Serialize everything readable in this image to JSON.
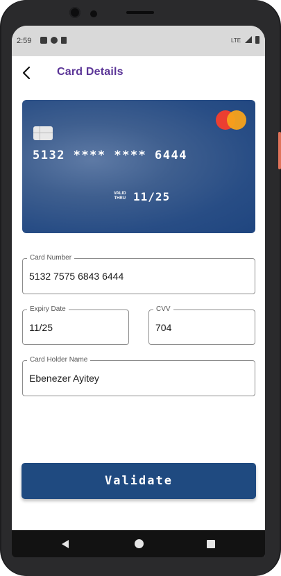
{
  "status_bar": {
    "time": "2:59",
    "network": "LTE",
    "icons": [
      "a-icon",
      "p-icon",
      "sim-card-icon",
      "signal-icon",
      "battery-icon"
    ]
  },
  "header": {
    "title": "Card Details",
    "back_icon": "arrow-back-icon"
  },
  "card_preview": {
    "masked_number": "5132 **** **** 6444",
    "valid_label_top": "VALID",
    "valid_label_bottom": "THRU",
    "expiry": "11/25",
    "brand": "mastercard"
  },
  "form": {
    "card_number": {
      "label": "Card Number",
      "value": "5132 7575 6843 6444"
    },
    "expiry_date": {
      "label": "Expiry Date",
      "value": "11/25"
    },
    "cvv": {
      "label": "CVV",
      "value": "704"
    },
    "card_holder": {
      "label": "Card Holder Name",
      "value": "Ebenezer Ayitey"
    }
  },
  "actions": {
    "validate_label": "Validate"
  },
  "colors": {
    "title": "#5b3597",
    "card_bg": "#284d85",
    "button_bg": "#1f4a80",
    "mastercard_red": "#eb3f31",
    "mastercard_yellow": "#f7a21b"
  }
}
